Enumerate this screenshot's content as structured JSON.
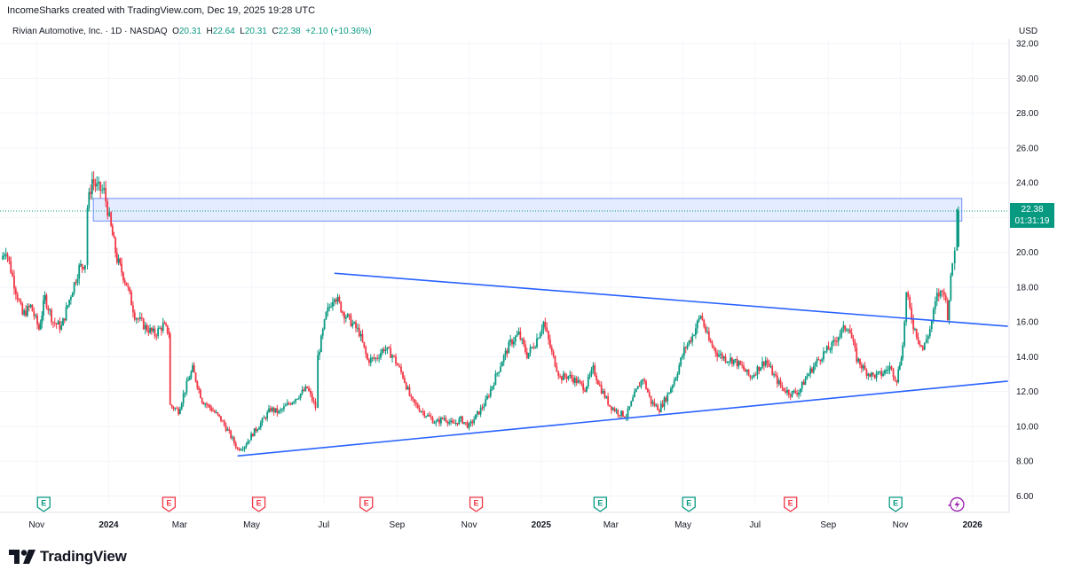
{
  "header": {
    "credit": "IncomeSharks created with TradingView.com, Dec 19, 2025 19:28 UTC",
    "symbol_text": "Rivian Automotive, Inc. · 1D · NASDAQ",
    "o_label": "O",
    "o_value": "20.31",
    "h_label": "H",
    "h_value": "22.64",
    "l_label": "L",
    "l_value": "20.31",
    "c_label": "C",
    "c_value": "22.38",
    "change": "+2.10 (+10.36%)",
    "currency": "USD"
  },
  "price_tag": {
    "price": "22.38",
    "countdown": "01:31:19"
  },
  "brand": {
    "name": "TradingView"
  },
  "colors": {
    "up": "#089981",
    "down": "#f23645",
    "trendline": "#2962ff",
    "zone_fill": "#dbe6ff",
    "zone_stroke": "#6f8ff7"
  },
  "chart_data": {
    "type": "candlestick",
    "symbol": "Rivian Automotive, Inc.",
    "interval": "1D",
    "exchange": "NASDAQ",
    "y_axis": {
      "ticks": [
        6,
        8,
        10,
        12,
        14,
        16,
        18,
        20,
        22,
        24,
        26,
        28,
        30,
        32
      ],
      "labels": [
        "6.00",
        "8.00",
        "10.00",
        "12.00",
        "14.00",
        "16.00",
        "18.00",
        "20.00",
        "22.00",
        "24.00",
        "26.00",
        "28.00",
        "30.00",
        "32.00"
      ]
    },
    "x_axis": {
      "labels": [
        "Nov",
        "2024",
        "Mar",
        "May",
        "Jul",
        "Sep",
        "Nov",
        "2025",
        "Mar",
        "May",
        "Jul",
        "Sep",
        "Nov",
        "2026"
      ],
      "bold": [
        "2024",
        "2025",
        "2026"
      ]
    },
    "price_path": [
      {
        "d": "2023-10-02",
        "p": 19.6
      },
      {
        "d": "2023-10-06",
        "p": 20.2
      },
      {
        "d": "2023-10-13",
        "p": 18.2
      },
      {
        "d": "2023-10-20",
        "p": 16.4
      },
      {
        "d": "2023-10-27",
        "p": 16.9
      },
      {
        "d": "2023-11-03",
        "p": 15.6
      },
      {
        "d": "2023-11-08",
        "p": 17.4
      },
      {
        "d": "2023-11-15",
        "p": 16.0
      },
      {
        "d": "2023-11-22",
        "p": 15.7
      },
      {
        "d": "2023-11-30",
        "p": 17.6
      },
      {
        "d": "2023-12-07",
        "p": 19.1
      },
      {
        "d": "2023-12-12",
        "p": 19.4
      },
      {
        "d": "2023-12-14",
        "p": 22.6
      },
      {
        "d": "2023-12-18",
        "p": 24.2
      },
      {
        "d": "2023-12-22",
        "p": 23.7
      },
      {
        "d": "2023-12-28",
        "p": 23.5
      },
      {
        "d": "2024-01-03",
        "p": 21.4
      },
      {
        "d": "2024-01-08",
        "p": 19.6
      },
      {
        "d": "2024-01-16",
        "p": 18.2
      },
      {
        "d": "2024-01-23",
        "p": 16.4
      },
      {
        "d": "2024-02-01",
        "p": 15.7
      },
      {
        "d": "2024-02-09",
        "p": 15.3
      },
      {
        "d": "2024-02-16",
        "p": 15.8
      },
      {
        "d": "2024-02-21",
        "p": 15.4
      },
      {
        "d": "2024-02-22",
        "p": 11.2
      },
      {
        "d": "2024-02-29",
        "p": 10.9
      },
      {
        "d": "2024-03-07",
        "p": 12.4
      },
      {
        "d": "2024-03-12",
        "p": 13.3
      },
      {
        "d": "2024-03-20",
        "p": 11.5
      },
      {
        "d": "2024-03-28",
        "p": 11.0
      },
      {
        "d": "2024-04-05",
        "p": 10.4
      },
      {
        "d": "2024-04-12",
        "p": 9.6
      },
      {
        "d": "2024-04-19",
        "p": 8.7
      },
      {
        "d": "2024-04-25",
        "p": 8.9
      },
      {
        "d": "2024-05-02",
        "p": 9.6
      },
      {
        "d": "2024-05-10",
        "p": 10.3
      },
      {
        "d": "2024-05-17",
        "p": 11.0
      },
      {
        "d": "2024-05-24",
        "p": 10.8
      },
      {
        "d": "2024-06-03",
        "p": 11.4
      },
      {
        "d": "2024-06-10",
        "p": 11.8
      },
      {
        "d": "2024-06-17",
        "p": 12.2
      },
      {
        "d": "2024-06-24",
        "p": 11.1
      },
      {
        "d": "2024-06-26",
        "p": 14.0
      },
      {
        "d": "2024-07-03",
        "p": 16.4
      },
      {
        "d": "2024-07-10",
        "p": 17.6
      },
      {
        "d": "2024-07-17",
        "p": 16.6
      },
      {
        "d": "2024-07-24",
        "p": 16.0
      },
      {
        "d": "2024-07-31",
        "p": 15.4
      },
      {
        "d": "2024-08-07",
        "p": 13.8
      },
      {
        "d": "2024-08-14",
        "p": 13.9
      },
      {
        "d": "2024-08-21",
        "p": 14.5
      },
      {
        "d": "2024-08-28",
        "p": 14.1
      },
      {
        "d": "2024-09-06",
        "p": 12.9
      },
      {
        "d": "2024-09-13",
        "p": 11.5
      },
      {
        "d": "2024-09-20",
        "p": 11.0
      },
      {
        "d": "2024-09-27",
        "p": 10.6
      },
      {
        "d": "2024-10-04",
        "p": 10.2
      },
      {
        "d": "2024-10-11",
        "p": 10.5
      },
      {
        "d": "2024-10-18",
        "p": 10.1
      },
      {
        "d": "2024-10-25",
        "p": 10.4
      },
      {
        "d": "2024-11-01",
        "p": 10.0
      },
      {
        "d": "2024-11-08",
        "p": 10.7
      },
      {
        "d": "2024-11-15",
        "p": 11.4
      },
      {
        "d": "2024-11-22",
        "p": 12.6
      },
      {
        "d": "2024-11-29",
        "p": 13.8
      },
      {
        "d": "2024-12-06",
        "p": 14.8
      },
      {
        "d": "2024-12-13",
        "p": 15.3
      },
      {
        "d": "2024-12-20",
        "p": 14.1
      },
      {
        "d": "2024-12-27",
        "p": 14.8
      },
      {
        "d": "2025-01-03",
        "p": 16.0
      },
      {
        "d": "2025-01-10",
        "p": 14.2
      },
      {
        "d": "2025-01-17",
        "p": 12.8
      },
      {
        "d": "2025-01-24",
        "p": 12.9
      },
      {
        "d": "2025-01-31",
        "p": 12.6
      },
      {
        "d": "2025-02-07",
        "p": 12.2
      },
      {
        "d": "2025-02-14",
        "p": 13.3
      },
      {
        "d": "2025-02-21",
        "p": 12.1
      },
      {
        "d": "2025-02-28",
        "p": 11.2
      },
      {
        "d": "2025-03-07",
        "p": 10.8
      },
      {
        "d": "2025-03-14",
        "p": 10.6
      },
      {
        "d": "2025-03-21",
        "p": 11.8
      },
      {
        "d": "2025-03-28",
        "p": 12.8
      },
      {
        "d": "2025-04-04",
        "p": 11.4
      },
      {
        "d": "2025-04-11",
        "p": 11.0
      },
      {
        "d": "2025-04-18",
        "p": 11.8
      },
      {
        "d": "2025-04-25",
        "p": 12.9
      },
      {
        "d": "2025-05-02",
        "p": 14.4
      },
      {
        "d": "2025-05-09",
        "p": 15.2
      },
      {
        "d": "2025-05-16",
        "p": 16.4
      },
      {
        "d": "2025-05-23",
        "p": 14.9
      },
      {
        "d": "2025-05-30",
        "p": 14.2
      },
      {
        "d": "2025-06-06",
        "p": 13.9
      },
      {
        "d": "2025-06-13",
        "p": 13.8
      },
      {
        "d": "2025-06-20",
        "p": 13.4
      },
      {
        "d": "2025-06-27",
        "p": 12.8
      },
      {
        "d": "2025-07-03",
        "p": 13.3
      },
      {
        "d": "2025-07-10",
        "p": 13.8
      },
      {
        "d": "2025-07-17",
        "p": 12.9
      },
      {
        "d": "2025-07-24",
        "p": 12.2
      },
      {
        "d": "2025-07-31",
        "p": 11.9
      },
      {
        "d": "2025-08-07",
        "p": 12.0
      },
      {
        "d": "2025-08-14",
        "p": 12.9
      },
      {
        "d": "2025-08-21",
        "p": 13.6
      },
      {
        "d": "2025-08-28",
        "p": 14.2
      },
      {
        "d": "2025-09-04",
        "p": 14.6
      },
      {
        "d": "2025-09-11",
        "p": 15.4
      },
      {
        "d": "2025-09-18",
        "p": 15.8
      },
      {
        "d": "2025-09-25",
        "p": 13.9
      },
      {
        "d": "2025-10-02",
        "p": 13.2
      },
      {
        "d": "2025-10-09",
        "p": 12.9
      },
      {
        "d": "2025-10-16",
        "p": 13.0
      },
      {
        "d": "2025-10-23",
        "p": 13.4
      },
      {
        "d": "2025-10-29",
        "p": 12.7
      },
      {
        "d": "2025-11-03",
        "p": 14.6
      },
      {
        "d": "2025-11-06",
        "p": 17.6
      },
      {
        "d": "2025-11-12",
        "p": 15.8
      },
      {
        "d": "2025-11-20",
        "p": 14.4
      },
      {
        "d": "2025-11-26",
        "p": 15.6
      },
      {
        "d": "2025-12-02",
        "p": 17.5
      },
      {
        "d": "2025-12-08",
        "p": 17.8
      },
      {
        "d": "2025-12-11",
        "p": 16.4
      },
      {
        "d": "2025-12-15",
        "p": 19.4
      },
      {
        "d": "2025-12-17",
        "p": 20.3
      },
      {
        "d": "2025-12-19",
        "p": 22.38
      }
    ],
    "last_candle": {
      "d": "2025-12-19",
      "o": 20.31,
      "h": 22.64,
      "l": 20.31,
      "c": 22.38
    },
    "annotations": {
      "resistance_zone": {
        "low": 21.8,
        "high": 23.1,
        "from": "2023-12-19",
        "to": "2025-12-23"
      },
      "upper_trendline": {
        "from": {
          "d": "2024-07-10",
          "p": 18.8
        },
        "to": {
          "d": "2026-01-31",
          "p": 15.75
        }
      },
      "lower_trendline": {
        "from": {
          "d": "2024-04-19",
          "p": 8.3
        },
        "to": {
          "d": "2026-01-31",
          "p": 12.6
        }
      },
      "last_price_line": 22.38
    },
    "events": [
      {
        "d": "2023-11-07",
        "type": "earnings",
        "status": "beat",
        "letter": "E"
      },
      {
        "d": "2024-02-21",
        "type": "earnings",
        "status": "miss",
        "letter": "E"
      },
      {
        "d": "2024-05-07",
        "type": "earnings",
        "status": "miss",
        "letter": "E"
      },
      {
        "d": "2024-08-06",
        "type": "earnings",
        "status": "miss",
        "letter": "E"
      },
      {
        "d": "2024-11-07",
        "type": "earnings",
        "status": "miss",
        "letter": "E"
      },
      {
        "d": "2025-02-20",
        "type": "earnings",
        "status": "beat",
        "letter": "E"
      },
      {
        "d": "2025-05-06",
        "type": "earnings",
        "status": "beat",
        "letter": "E"
      },
      {
        "d": "2025-07-31",
        "type": "earnings",
        "status": "miss",
        "letter": "E"
      },
      {
        "d": "2025-10-28",
        "type": "earnings",
        "status": "beat",
        "letter": "E"
      },
      {
        "d": "2025-12-19",
        "type": "event",
        "status": "pending",
        "letter": ""
      }
    ]
  }
}
